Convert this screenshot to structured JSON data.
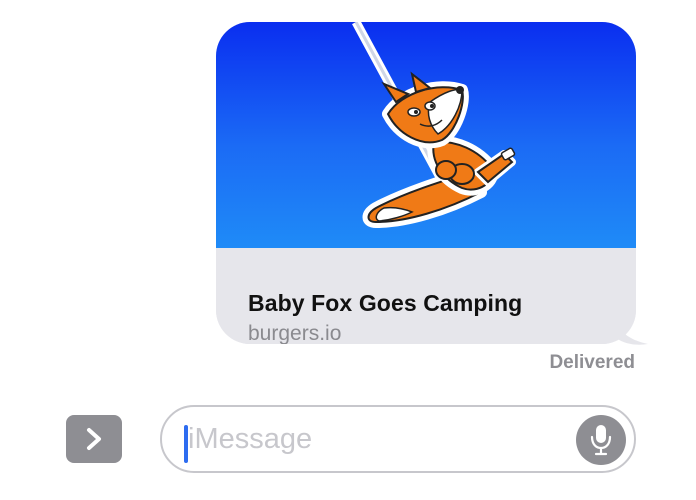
{
  "link_preview": {
    "title": "Baby Fox Goes Camping",
    "domain": "burgers.io",
    "image": "baby-fox-cartoon-on-swing"
  },
  "status": {
    "delivered": "Delivered"
  },
  "input_bar": {
    "placeholder": "iMessage",
    "expand_icon": "chevron-right-icon",
    "mic_icon": "microphone-icon"
  },
  "colors": {
    "image_gradient_top": "#0a2ef0",
    "image_gradient_bottom": "#1f8bf7",
    "bubble_background": "#e6e6eb",
    "fox_orange": "#f07a16",
    "caret": "#2d6cf0",
    "gray_control": "#8e8e93"
  }
}
